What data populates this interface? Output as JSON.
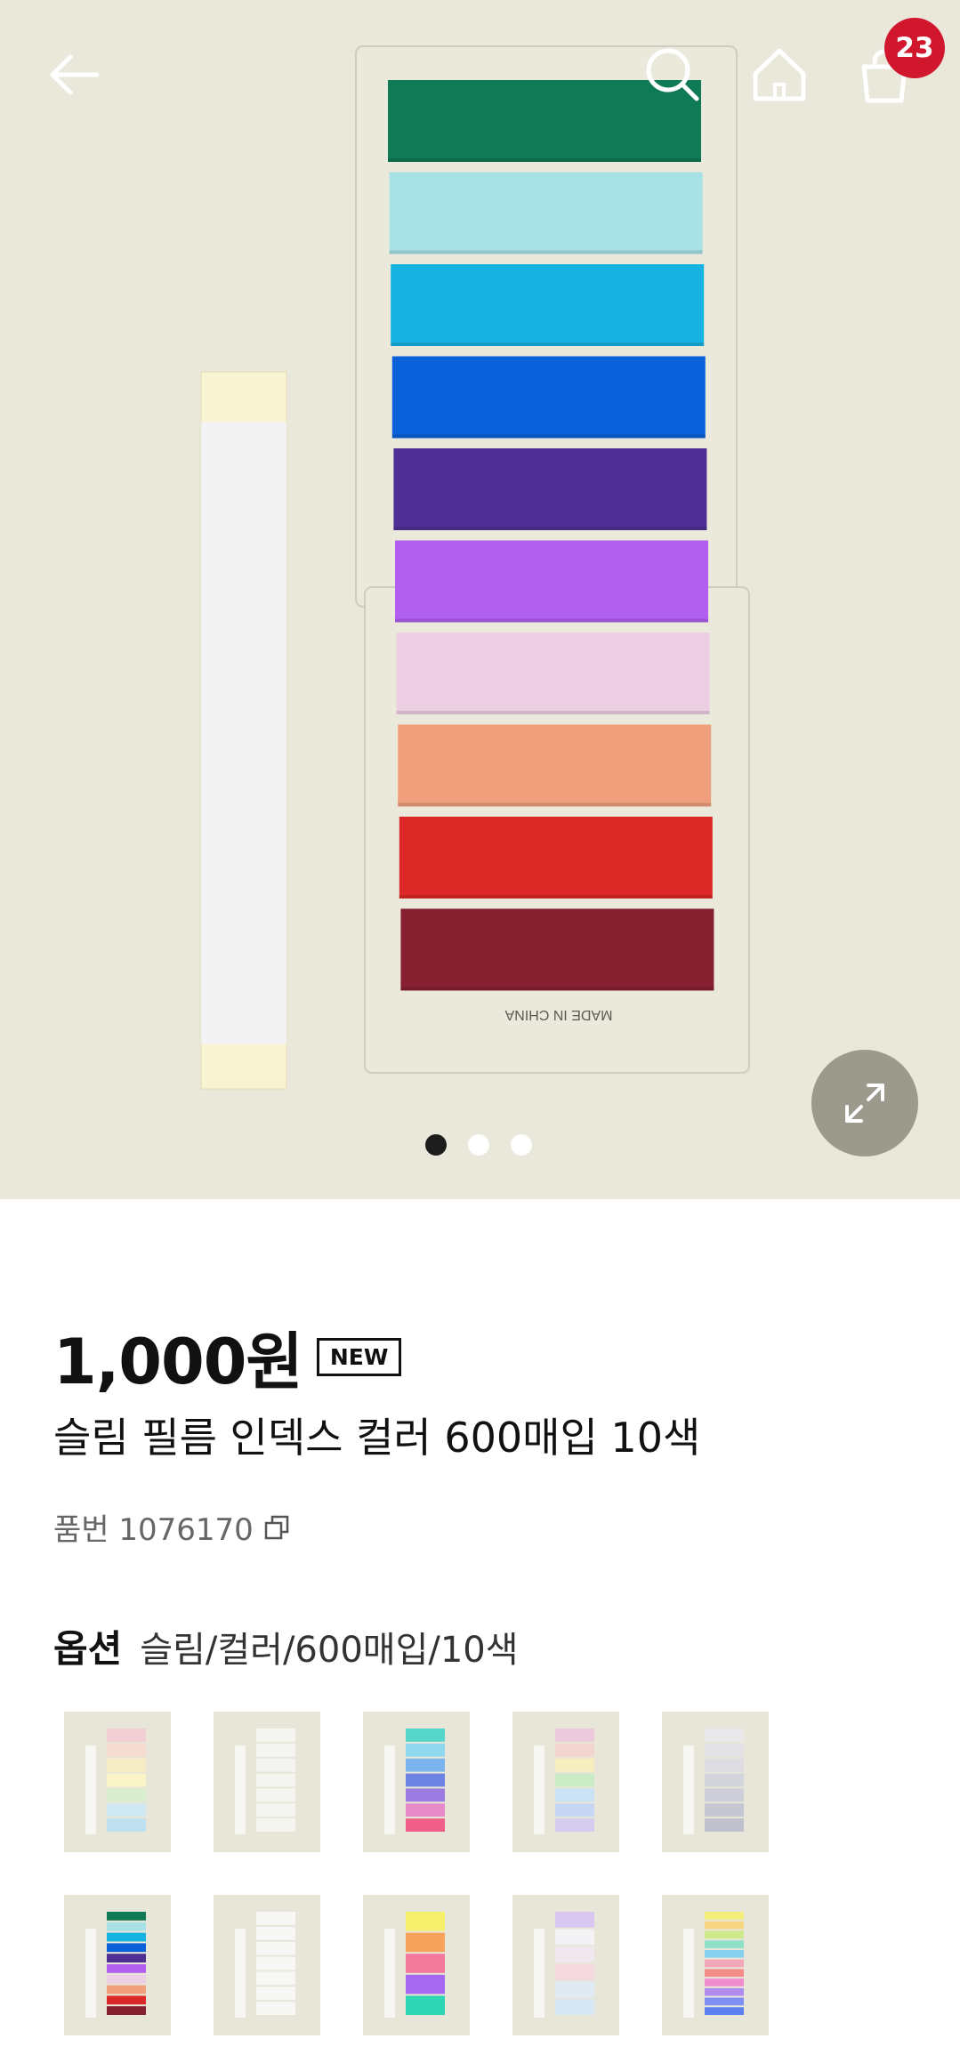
{
  "header": {
    "back_icon": "arrow-left-icon",
    "search_icon": "search-icon",
    "home_icon": "home-icon",
    "cart_icon": "shopping-bag-icon",
    "cart_count": "23"
  },
  "gallery": {
    "expand_icon": "expand-icon",
    "page_count": 3,
    "active_page": 1,
    "product_print": "MADE IN CHINA",
    "tab_colors": [
      "#0f7a55",
      "#a7e1e6",
      "#16b3e2",
      "#0a61da",
      "#4f2f95",
      "#b15fee",
      "#eccfe2",
      "#f09f7c",
      "#dc2826",
      "#862131"
    ]
  },
  "product": {
    "price": "1,000원",
    "badge": "NEW",
    "title": "슬림 필름 인덱스 컬러 600매입 10색",
    "sku_label": "품번 1076170",
    "option_label": "옵션",
    "option_value": "슬림/컬러/600매입/10색"
  },
  "options": {
    "selected_index": 5,
    "thumbnails": [
      {
        "name": "option-thumb-pastel-pink-yellow",
        "colors": [
          "#f2cfd4",
          "#f6dcd0",
          "#f7ecc4",
          "#f8f4c8",
          "#d8eecf",
          "#cfe8f2",
          "#bfe0ef"
        ]
      },
      {
        "name": "option-thumb-white-slim",
        "colors": [
          "#f4f4f0",
          "#f4f4f0",
          "#f4f4f0",
          "#f4f4f0",
          "#f4f4f0",
          "#f4f4f0",
          "#f4f4f0"
        ]
      },
      {
        "name": "option-thumb-cyan-pink",
        "colors": [
          "#56d6c8",
          "#8fd8ee",
          "#7ab3ee",
          "#6e84e5",
          "#9a7be0",
          "#e68ac8",
          "#f05f8a"
        ]
      },
      {
        "name": "option-thumb-pastel-mix",
        "colors": [
          "#ecc9dd",
          "#f3d5cf",
          "#f7edbe",
          "#cbebc6",
          "#c9e2f4",
          "#c7d6f2",
          "#d6ccef"
        ]
      },
      {
        "name": "option-thumb-gray",
        "colors": [
          "#e9e9ec",
          "#e3e3e7",
          "#dcdce2",
          "#d4d4dc",
          "#cdced7",
          "#c6c7d2",
          "#c0c1cd"
        ]
      },
      {
        "name": "option-thumb-color-10",
        "colors": [
          "#0f7a55",
          "#a7e1e6",
          "#16b3e2",
          "#0a61da",
          "#4f2f95",
          "#b15fee",
          "#eccfe2",
          "#f09f7c",
          "#dc2826",
          "#862131"
        ]
      },
      {
        "name": "option-thumb-white-wide",
        "colors": [
          "#f7f7f5",
          "#f7f7f5",
          "#f7f7f5",
          "#f7f7f5",
          "#f7f7f5",
          "#f7f7f5",
          "#f7f7f5"
        ]
      },
      {
        "name": "option-thumb-neon",
        "colors": [
          "#f7f06a",
          "#f5a35c",
          "#f2789c",
          "#a66af0",
          "#2ed5b2"
        ]
      },
      {
        "name": "option-thumb-pastel-light",
        "colors": [
          "#d8c8f0",
          "#f3f3f6",
          "#f1e7ef",
          "#f3d8e0",
          "#e0eaf2",
          "#d7e7f3"
        ]
      },
      {
        "name": "option-thumb-arrow-rainbow",
        "colors": [
          "#f4ee7a",
          "#f7d783",
          "#cde98a",
          "#8fe0c8",
          "#86d0ee",
          "#f3a8b9",
          "#f58c8c",
          "#f28cd0",
          "#b18cf0",
          "#7f8ff2",
          "#5e7ff0"
        ]
      }
    ]
  }
}
